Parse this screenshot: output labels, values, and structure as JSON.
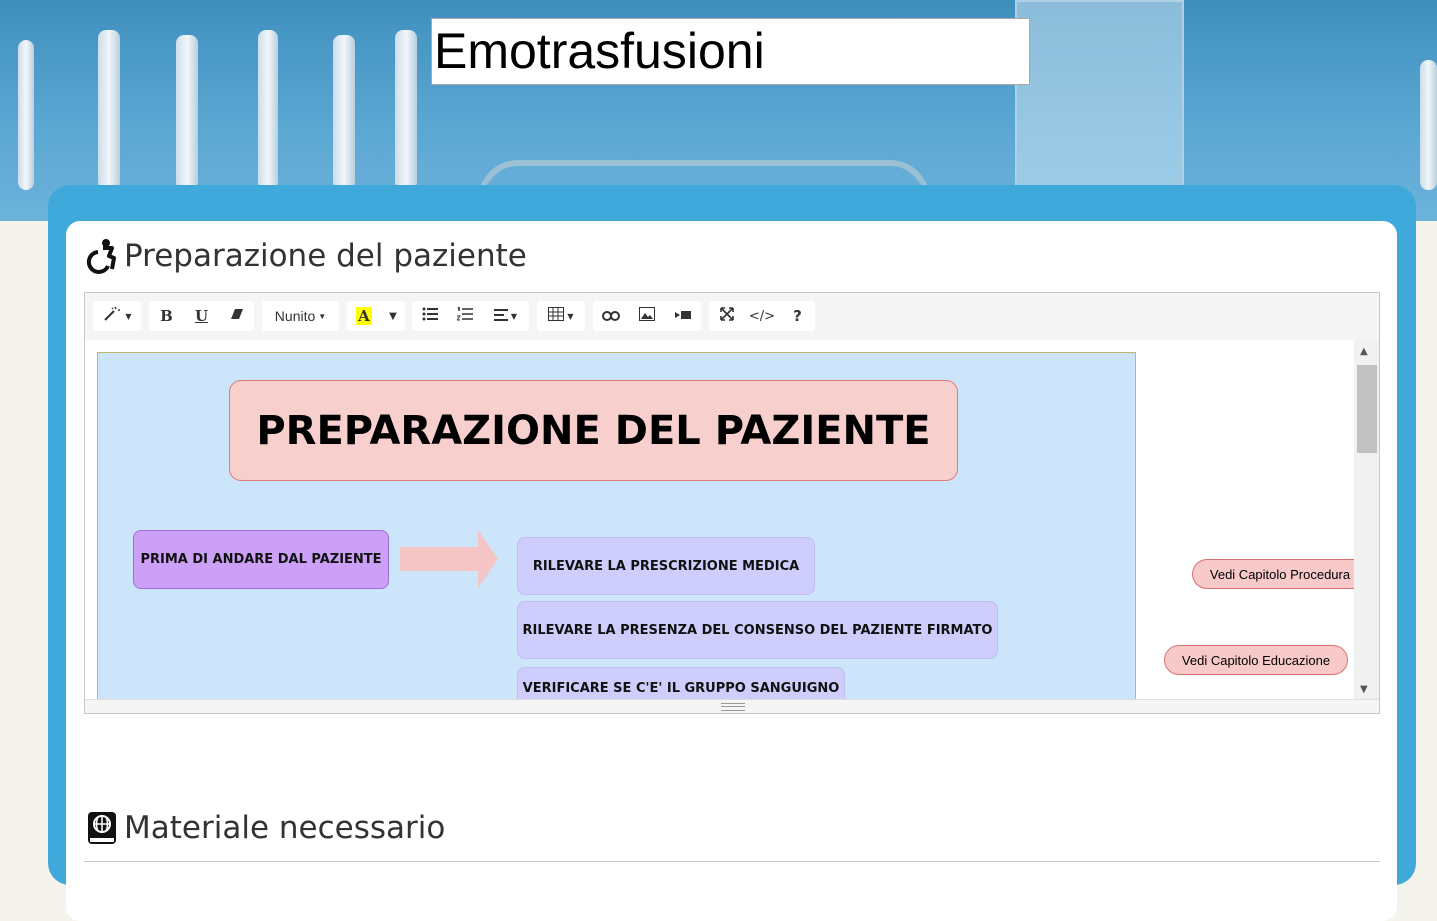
{
  "page": {
    "title": "Emotrasfusioni"
  },
  "sections": [
    {
      "title": "Preparazione del paziente",
      "icon": "wheelchair-icon"
    },
    {
      "title": "Materiale necessario",
      "icon": "book-globe-icon"
    }
  ],
  "toolbar": {
    "font_name": "Nunito",
    "bold": "B",
    "underline": "U",
    "code": "</>",
    "help": "?",
    "highlight_letter": "A",
    "highlight_color": "#ffff00"
  },
  "diagram": {
    "title": "PREPARAZIONE DEL PAZIENTE",
    "start_node": "PRIMA DI ANDARE DAL PAZIENTE",
    "steps": [
      "RILEVARE LA PRESCRIZIONE MEDICA",
      "RILEVARE LA PRESENZA DEL CONSENSO DEL PAZIENTE FIRMATO",
      "VERIFICARE SE C'E' IL GRUPPO SANGUIGNO"
    ],
    "links": [
      "Vedi  Capitolo Procedura",
      "Vedi  Capitolo Educazione"
    ]
  },
  "colors": {
    "banner": "#4a9acb",
    "card": "#3fa9dc",
    "diagram_bg": "#cde5fb",
    "title_box": "#f7cfcd",
    "purple_node": "#cba0f6",
    "lavender_node": "#cfcdfc"
  }
}
